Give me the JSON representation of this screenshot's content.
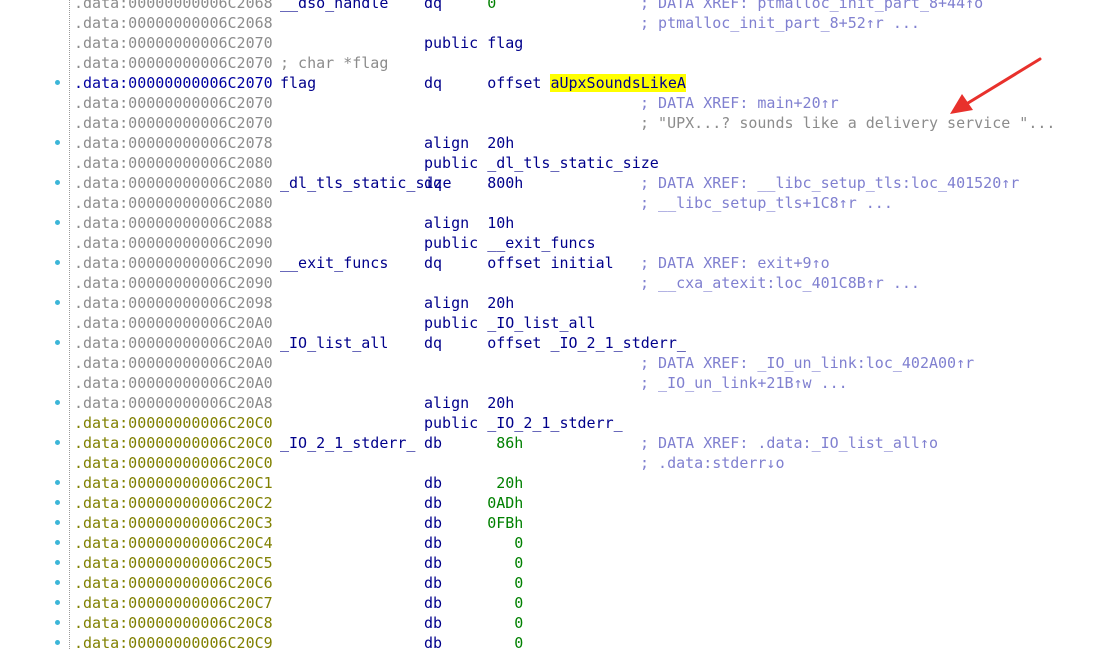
{
  "colors": {
    "address_gray": "#8c8c8c",
    "address_olive": "#808000",
    "keyword_blue": "#00008b",
    "comment_lavender": "#8080d0",
    "number_green": "#008000",
    "highlight": "#ffff00",
    "annotation_arrow": "#e8312c",
    "breakpoint_dot": "#3cb6d8"
  },
  "icons": {
    "annotation": "red-arrow-icon",
    "gutter_marker": "dot-icon"
  },
  "rows": [
    {
      "addr": ".data:00000000006C2068",
      "addr_style": "gray",
      "dot": false,
      "name": "__dso_handle",
      "mn": "dq",
      "op": "0",
      "op_style": "num",
      "cmt": "; DATA XREF: ptmalloc_init_part_8+44↑o"
    },
    {
      "addr": ".data:00000000006C2068",
      "addr_style": "gray",
      "dot": false,
      "name": "",
      "mn": "",
      "op": "",
      "op_style": "",
      "cmt": "; ptmalloc_init_part_8+52↑r ..."
    },
    {
      "addr": ".data:00000000006C2070",
      "addr_style": "gray",
      "dot": false,
      "name": "",
      "mn": "public",
      "op": "flag",
      "op_style": "name",
      "cmt": ""
    },
    {
      "addr": ".data:00000000006C2070",
      "addr_style": "gray",
      "dot": false,
      "name": "; char *flag",
      "name_style": "gray",
      "mn": "",
      "op": "",
      "op_style": "",
      "cmt": ""
    },
    {
      "addr": ".data:00000000006C2070",
      "addr_style": "blue",
      "dot": true,
      "name": "flag",
      "mn": "dq",
      "op_prefix": "offset ",
      "op": "aUpxSoundsLikeA",
      "op_style": "highlight",
      "cmt": ""
    },
    {
      "addr": ".data:00000000006C2070",
      "addr_style": "gray",
      "dot": false,
      "name": "",
      "mn": "",
      "op": "",
      "op_style": "",
      "cmt": "; DATA XREF: main+20↑r"
    },
    {
      "addr": ".data:00000000006C2070",
      "addr_style": "gray",
      "dot": false,
      "name": "",
      "mn": "",
      "op": "",
      "op_style": "",
      "cmt": "; \"UPX...? sounds like a delivery service \"...",
      "cmt_style": "gray"
    },
    {
      "addr": ".data:00000000006C2078",
      "addr_style": "gray",
      "dot": true,
      "name": "",
      "mn": "align",
      "op": "20h",
      "op_style": "name",
      "cmt": ""
    },
    {
      "addr": ".data:00000000006C2080",
      "addr_style": "gray",
      "dot": false,
      "name": "",
      "mn": "public",
      "op": "_dl_tls_static_size",
      "op_style": "name",
      "cmt": ""
    },
    {
      "addr": ".data:00000000006C2080",
      "addr_style": "gray",
      "dot": true,
      "name": "_dl_tls_static_size",
      "mn": "dq",
      "op": "800h",
      "op_style": "name",
      "cmt": "; DATA XREF: __libc_setup_tls:loc_401520↑r"
    },
    {
      "addr": ".data:00000000006C2080",
      "addr_style": "gray",
      "dot": false,
      "name": "",
      "mn": "",
      "op": "",
      "op_style": "",
      "cmt": "; __libc_setup_tls+1C8↑r ..."
    },
    {
      "addr": ".data:00000000006C2088",
      "addr_style": "gray",
      "dot": true,
      "name": "",
      "mn": "align",
      "op": "10h",
      "op_style": "name",
      "cmt": ""
    },
    {
      "addr": ".data:00000000006C2090",
      "addr_style": "gray",
      "dot": false,
      "name": "",
      "mn": "public",
      "op": "__exit_funcs",
      "op_style": "name",
      "cmt": ""
    },
    {
      "addr": ".data:00000000006C2090",
      "addr_style": "gray",
      "dot": true,
      "name": "__exit_funcs",
      "mn": "dq",
      "op_prefix": "offset ",
      "op": "initial",
      "op_style": "name",
      "cmt": "; DATA XREF: exit+9↑o"
    },
    {
      "addr": ".data:00000000006C2090",
      "addr_style": "gray",
      "dot": false,
      "name": "",
      "mn": "",
      "op": "",
      "op_style": "",
      "cmt": "; __cxa_atexit:loc_401C8B↑r ..."
    },
    {
      "addr": ".data:00000000006C2098",
      "addr_style": "gray",
      "dot": true,
      "name": "",
      "mn": "align",
      "op": "20h",
      "op_style": "name",
      "cmt": ""
    },
    {
      "addr": ".data:00000000006C20A0",
      "addr_style": "gray",
      "dot": false,
      "name": "",
      "mn": "public",
      "op": "_IO_list_all",
      "op_style": "name",
      "cmt": ""
    },
    {
      "addr": ".data:00000000006C20A0",
      "addr_style": "gray",
      "dot": true,
      "name": "_IO_list_all",
      "mn": "dq",
      "op_prefix": "offset ",
      "op": "_IO_2_1_stderr_",
      "op_style": "name",
      "cmt": ""
    },
    {
      "addr": ".data:00000000006C20A0",
      "addr_style": "gray",
      "dot": false,
      "name": "",
      "mn": "",
      "op": "",
      "op_style": "",
      "cmt": "; DATA XREF: _IO_un_link:loc_402A00↑r"
    },
    {
      "addr": ".data:00000000006C20A0",
      "addr_style": "gray",
      "dot": false,
      "name": "",
      "mn": "",
      "op": "",
      "op_style": "",
      "cmt": "; _IO_un_link+21B↑w ..."
    },
    {
      "addr": ".data:00000000006C20A8",
      "addr_style": "gray",
      "dot": true,
      "name": "",
      "mn": "align",
      "op": "20h",
      "op_style": "name",
      "cmt": ""
    },
    {
      "addr": ".data:00000000006C20C0",
      "addr_style": "olive",
      "dot": false,
      "name": "",
      "mn": "public",
      "op": "_IO_2_1_stderr_",
      "op_style": "name",
      "cmt": ""
    },
    {
      "addr": ".data:00000000006C20C0",
      "addr_style": "olive",
      "dot": true,
      "name": "_IO_2_1_stderr_",
      "mn": "db",
      "op": " 86h",
      "op_style": "num",
      "cmt": "; DATA XREF: .data:_IO_list_all↑o"
    },
    {
      "addr": ".data:00000000006C20C0",
      "addr_style": "olive",
      "dot": false,
      "name": "",
      "mn": "",
      "op": "",
      "op_style": "",
      "cmt": "; .data:stderr↓o"
    },
    {
      "addr": ".data:00000000006C20C1",
      "addr_style": "olive",
      "dot": true,
      "name": "",
      "mn": "db",
      "op": " 20h",
      "op_style": "num",
      "cmt": ""
    },
    {
      "addr": ".data:00000000006C20C2",
      "addr_style": "olive",
      "dot": true,
      "name": "",
      "mn": "db",
      "op": "0ADh",
      "op_style": "num",
      "cmt": ""
    },
    {
      "addr": ".data:00000000006C20C3",
      "addr_style": "olive",
      "dot": true,
      "name": "",
      "mn": "db",
      "op": "0FBh",
      "op_style": "num",
      "cmt": ""
    },
    {
      "addr": ".data:00000000006C20C4",
      "addr_style": "olive",
      "dot": true,
      "name": "",
      "mn": "db",
      "op": "   0",
      "op_style": "num",
      "cmt": ""
    },
    {
      "addr": ".data:00000000006C20C5",
      "addr_style": "olive",
      "dot": true,
      "name": "",
      "mn": "db",
      "op": "   0",
      "op_style": "num",
      "cmt": ""
    },
    {
      "addr": ".data:00000000006C20C6",
      "addr_style": "olive",
      "dot": true,
      "name": "",
      "mn": "db",
      "op": "   0",
      "op_style": "num",
      "cmt": ""
    },
    {
      "addr": ".data:00000000006C20C7",
      "addr_style": "olive",
      "dot": true,
      "name": "",
      "mn": "db",
      "op": "   0",
      "op_style": "num",
      "cmt": ""
    },
    {
      "addr": ".data:00000000006C20C8",
      "addr_style": "olive",
      "dot": true,
      "name": "",
      "mn": "db",
      "op": "   0",
      "op_style": "num",
      "cmt": ""
    },
    {
      "addr": ".data:00000000006C20C9",
      "addr_style": "olive",
      "dot": true,
      "name": "",
      "mn": "db",
      "op": "   0",
      "op_style": "num",
      "cmt": ""
    }
  ]
}
